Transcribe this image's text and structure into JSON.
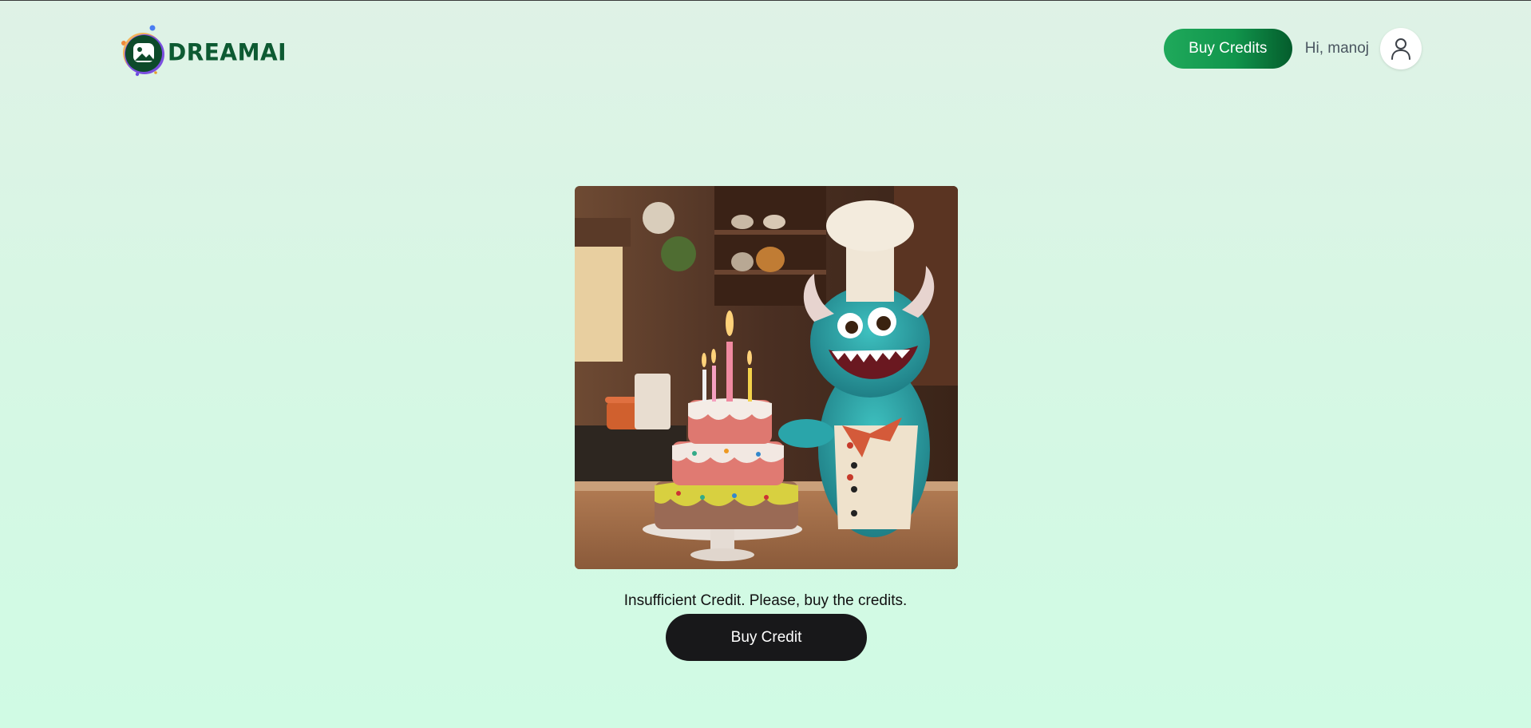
{
  "header": {
    "logo_text": "DREAMAI",
    "buy_credits_label": "Buy Credits",
    "greeting": "Hi, manoj"
  },
  "main": {
    "image_icon": "monster-chef-with-birthday-cake-image",
    "message": "Insufficient Credit. Please, buy the credits.",
    "buy_credit_label": "Buy Credit"
  },
  "colors": {
    "brand_green": "#0d5a32",
    "button_green": "#11954c",
    "button_dark": "#18181a"
  }
}
